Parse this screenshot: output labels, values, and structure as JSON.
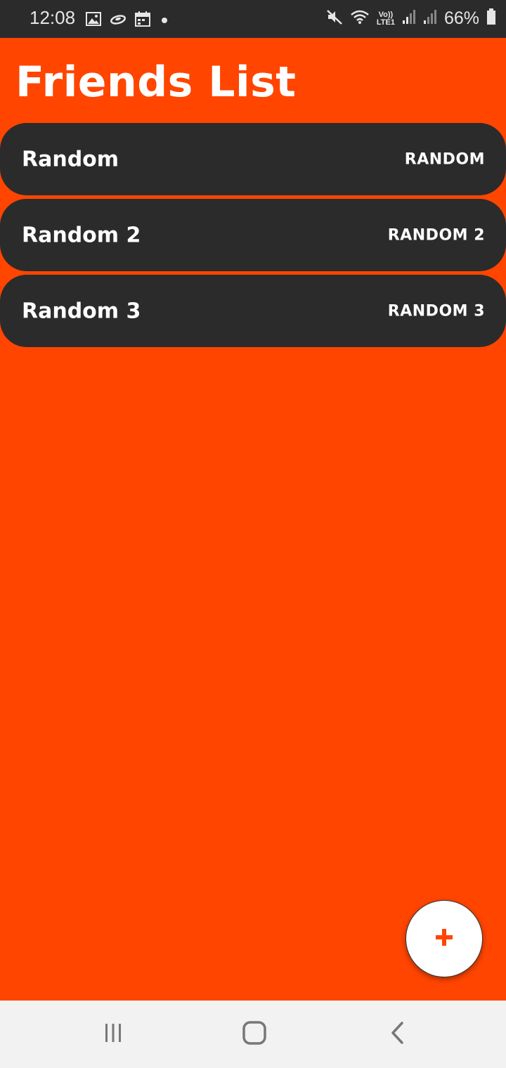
{
  "status_bar": {
    "time": "12:08",
    "battery_percent": "66%",
    "left_icons": [
      "gallery-icon",
      "sync-icon",
      "calendar-icon",
      "dot-icon"
    ],
    "right_icons": [
      "mute-icon",
      "wifi-icon",
      "volte-icon",
      "signal-icon",
      "signal-icon",
      "battery-icon"
    ],
    "volte_label_top": "Vo))",
    "volte_label_bottom": "LTE1"
  },
  "header": {
    "title": "Friends List"
  },
  "friends": [
    {
      "name": "Random",
      "tag": "RANDOM"
    },
    {
      "name": "Random 2",
      "tag": "RANDOM 2"
    },
    {
      "name": "Random 3",
      "tag": "RANDOM 3"
    }
  ],
  "fab": {
    "icon": "plus-icon",
    "color": "#ff4500"
  },
  "nav_bar": {
    "buttons": [
      "recent-apps-icon",
      "home-icon",
      "back-icon"
    ]
  },
  "colors": {
    "background": "#ff4500",
    "card": "#2b2b2b",
    "status_bar": "#2b2b2b",
    "nav_bar": "#f2f2f2"
  }
}
